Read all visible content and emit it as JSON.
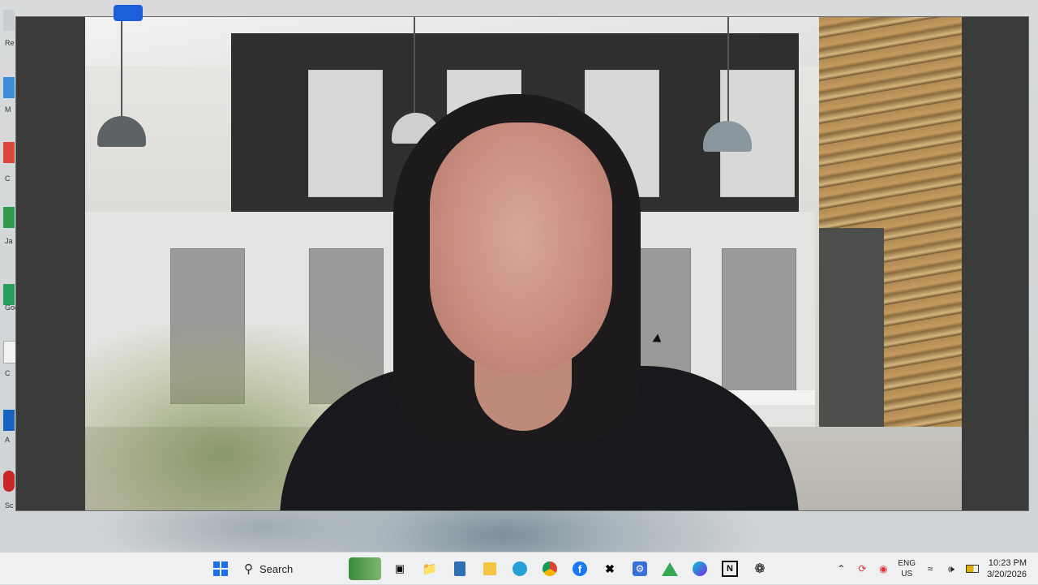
{
  "taskbar": {
    "search_label": "Search",
    "apps": [
      {
        "name": "start-icon",
        "color": "#1a73e8"
      },
      {
        "name": "widgets-icon",
        "color": "#3b8b3b"
      },
      {
        "name": "file-explorer-icon",
        "color": "#f2b01e"
      },
      {
        "name": "calculator-icon",
        "color": "#2f6fb5"
      },
      {
        "name": "sticky-notes-icon",
        "color": "#f4c542"
      },
      {
        "name": "edge-icon",
        "color": "#27a0d6"
      },
      {
        "name": "chrome-icon",
        "color": "#db4437"
      },
      {
        "name": "facebook-icon",
        "color": "#1877f2"
      },
      {
        "name": "capcut-icon",
        "color": "#111111"
      },
      {
        "name": "settings-app-icon",
        "color": "#3a6fd8"
      },
      {
        "name": "google-drive-icon",
        "color": "#34a853"
      },
      {
        "name": "canva-icon",
        "color": "#00c4cc"
      },
      {
        "name": "notion-icon",
        "color": "#111111"
      },
      {
        "name": "chatgpt-icon",
        "color": "#111111"
      }
    ],
    "tray": {
      "language": "ENG",
      "region": "US",
      "time": "10:23 PM",
      "date": "3/20/2026"
    }
  },
  "desktop": {
    "labels": [
      "Re",
      "M",
      "C",
      "Ja",
      "Goo",
      "C",
      "A",
      "Sc"
    ]
  }
}
